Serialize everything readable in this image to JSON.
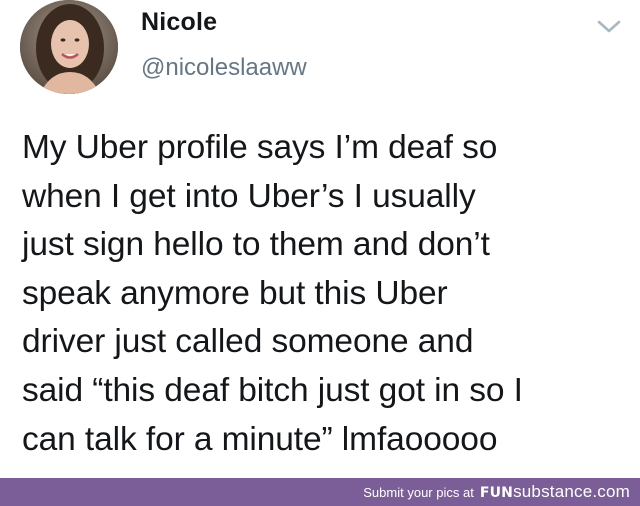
{
  "tweet": {
    "display_name": "Nicole",
    "handle": "@nicoleslaaww",
    "text": "My Uber profile says I’m deaf so\nwhen I get into Uber’s I usually\njust sign hello to them and don’t\nspeak anymore but this Uber\ndriver just called someone and\nsaid “this deaf bitch just got in so I\ncan talk for a minute” lmfaooooo",
    "avatar_icon": "profile-photo",
    "menu_icon": "chevron-down-icon"
  },
  "footer": {
    "submit_text": "Submit your pics at",
    "brand_fun": "FUN",
    "brand_rest": "substance.com",
    "background_color": "#7b5e97"
  },
  "colors": {
    "name": "#14171a",
    "handle": "#657786",
    "chevron": "#aab8c2"
  }
}
